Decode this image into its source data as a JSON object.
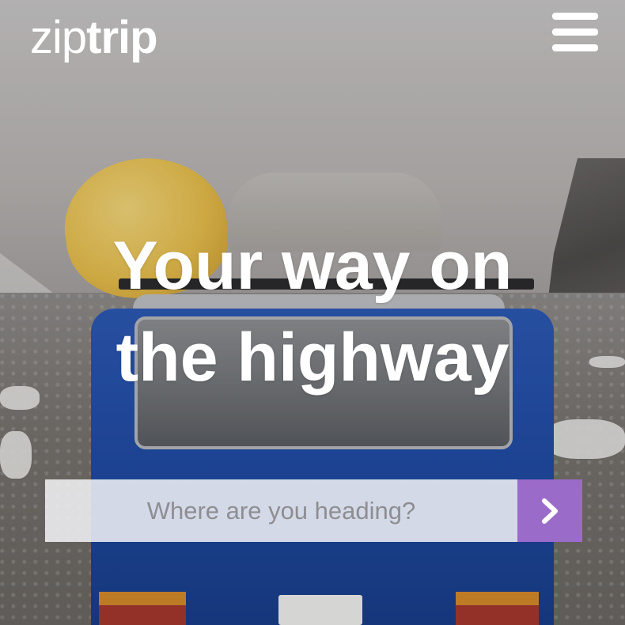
{
  "app": {
    "logo_light": "zip",
    "logo_bold": "trip"
  },
  "header": {
    "menu_icon": "hamburger-menu-icon"
  },
  "hero": {
    "title_line1": "Your way on",
    "title_line2": "the highway"
  },
  "search": {
    "placeholder": "Where are you heading?",
    "value": "",
    "submit_icon": "chevron-right-icon"
  },
  "colors": {
    "accent": "#9b6bc9",
    "text_on_image": "#ffffff",
    "input_background": "#f5f5f7"
  }
}
